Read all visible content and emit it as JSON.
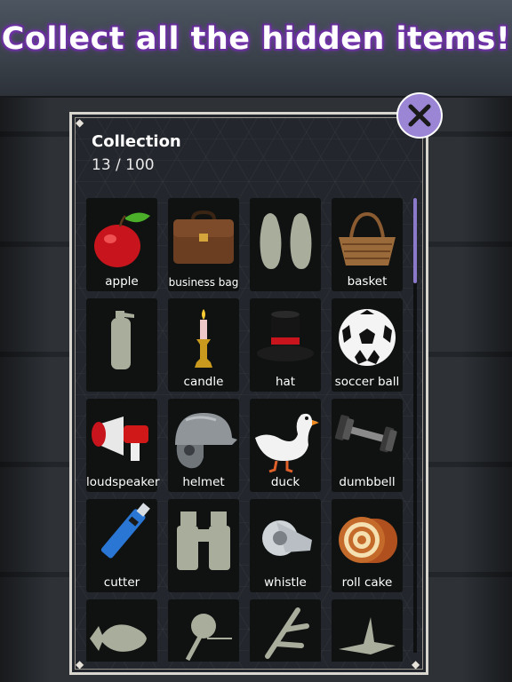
{
  "banner": {
    "text": "Collect all the hidden items!"
  },
  "collection": {
    "title": "Collection",
    "count": "13 / 100",
    "scroll_position": 0.0
  },
  "colors": {
    "accent": "#9b86d6",
    "tile_bg": "#0f1211",
    "silhouette": "#a8ad9c"
  },
  "items": [
    {
      "label": "apple",
      "icon": "apple-icon",
      "found": true
    },
    {
      "label": "business bag",
      "icon": "business-bag-icon",
      "found": true
    },
    {
      "label": "",
      "icon": "sandals-silhouette-icon",
      "found": false
    },
    {
      "label": "basket",
      "icon": "basket-icon",
      "found": true
    },
    {
      "label": "",
      "icon": "fire-extinguisher-silhouette-icon",
      "found": false
    },
    {
      "label": "candle",
      "icon": "candle-icon",
      "found": true
    },
    {
      "label": "hat",
      "icon": "top-hat-icon",
      "found": true
    },
    {
      "label": "soccer ball",
      "icon": "soccer-ball-icon",
      "found": true
    },
    {
      "label": "loudspeaker",
      "icon": "loudspeaker-icon",
      "found": true
    },
    {
      "label": "helmet",
      "icon": "helmet-icon",
      "found": true
    },
    {
      "label": "duck",
      "icon": "duck-icon",
      "found": true
    },
    {
      "label": "dumbbell",
      "icon": "dumbbell-icon",
      "found": true
    },
    {
      "label": "cutter",
      "icon": "cutter-icon",
      "found": true
    },
    {
      "label": "",
      "icon": "binoculars-silhouette-icon",
      "found": false
    },
    {
      "label": "whistle",
      "icon": "whistle-icon",
      "found": true
    },
    {
      "label": "roll cake",
      "icon": "roll-cake-icon",
      "found": true
    },
    {
      "label": "",
      "icon": "fish-silhouette-icon",
      "found": false
    },
    {
      "label": "",
      "icon": "fan-silhouette-icon",
      "found": false
    },
    {
      "label": "",
      "icon": "branch-silhouette-icon",
      "found": false
    },
    {
      "label": "",
      "icon": "bird-silhouette-icon",
      "found": false
    }
  ]
}
